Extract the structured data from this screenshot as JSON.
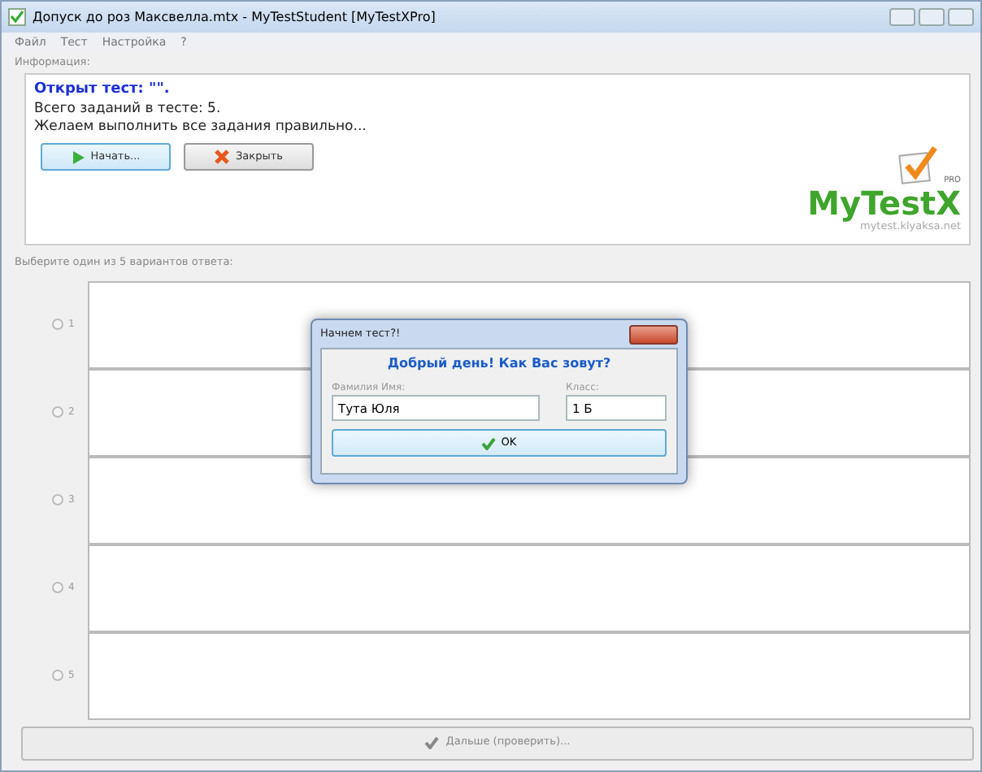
{
  "window": {
    "title": "Допуск до роз Максвелла.mtx - MyTestStudent [MyTestXPro]"
  },
  "menu": [
    "Файл",
    "Тест",
    "Настройка",
    "?"
  ],
  "info": {
    "label": "Информация:",
    "heading": "Открыт тест: \"\".",
    "lines": [
      "Всего заданий в тесте: 5.",
      "Желаем выполнить все задания правильно..."
    ],
    "buttons": [
      {
        "kind": "start",
        "label": "Начать...",
        "focused": true
      },
      {
        "kind": "close",
        "label": "Закрыть",
        "focused": false
      }
    ],
    "logo": {
      "pro": "PRO",
      "name": "MyTestX",
      "url": "mytest.klyaksa.net"
    }
  },
  "prompt": "Выберите один из 5 вариантов ответа:",
  "answers": [
    {
      "label": "1",
      "selected": false
    },
    {
      "label": "2",
      "selected": false
    },
    {
      "label": "3",
      "selected": false
    },
    {
      "label": "4",
      "selected": false
    },
    {
      "label": "5",
      "selected": false
    }
  ],
  "next_button": {
    "label": "Дальше (проверить)...",
    "disabled": true
  },
  "dialog": {
    "title": "Начнем тест?!",
    "greeting": "Добрый день! Как Вас зовут?",
    "fields": [
      {
        "label": "Фамилия Имя:",
        "value": "Тута Юля"
      },
      {
        "label": "Класс:",
        "value": "1 Б"
      }
    ],
    "ok": "OK"
  }
}
